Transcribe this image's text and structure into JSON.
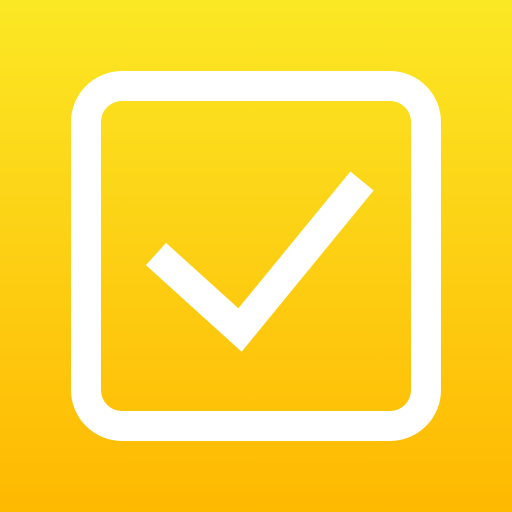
{
  "app_icon": {
    "icon": "checkbox-checked-icon",
    "colors": {
      "gradient_top": "#FBE824",
      "gradient_middle": "#FDCD12",
      "gradient_bottom": "#FEB901",
      "glyph": "#FFFFFF"
    },
    "checkbox": {
      "checked": true
    }
  }
}
